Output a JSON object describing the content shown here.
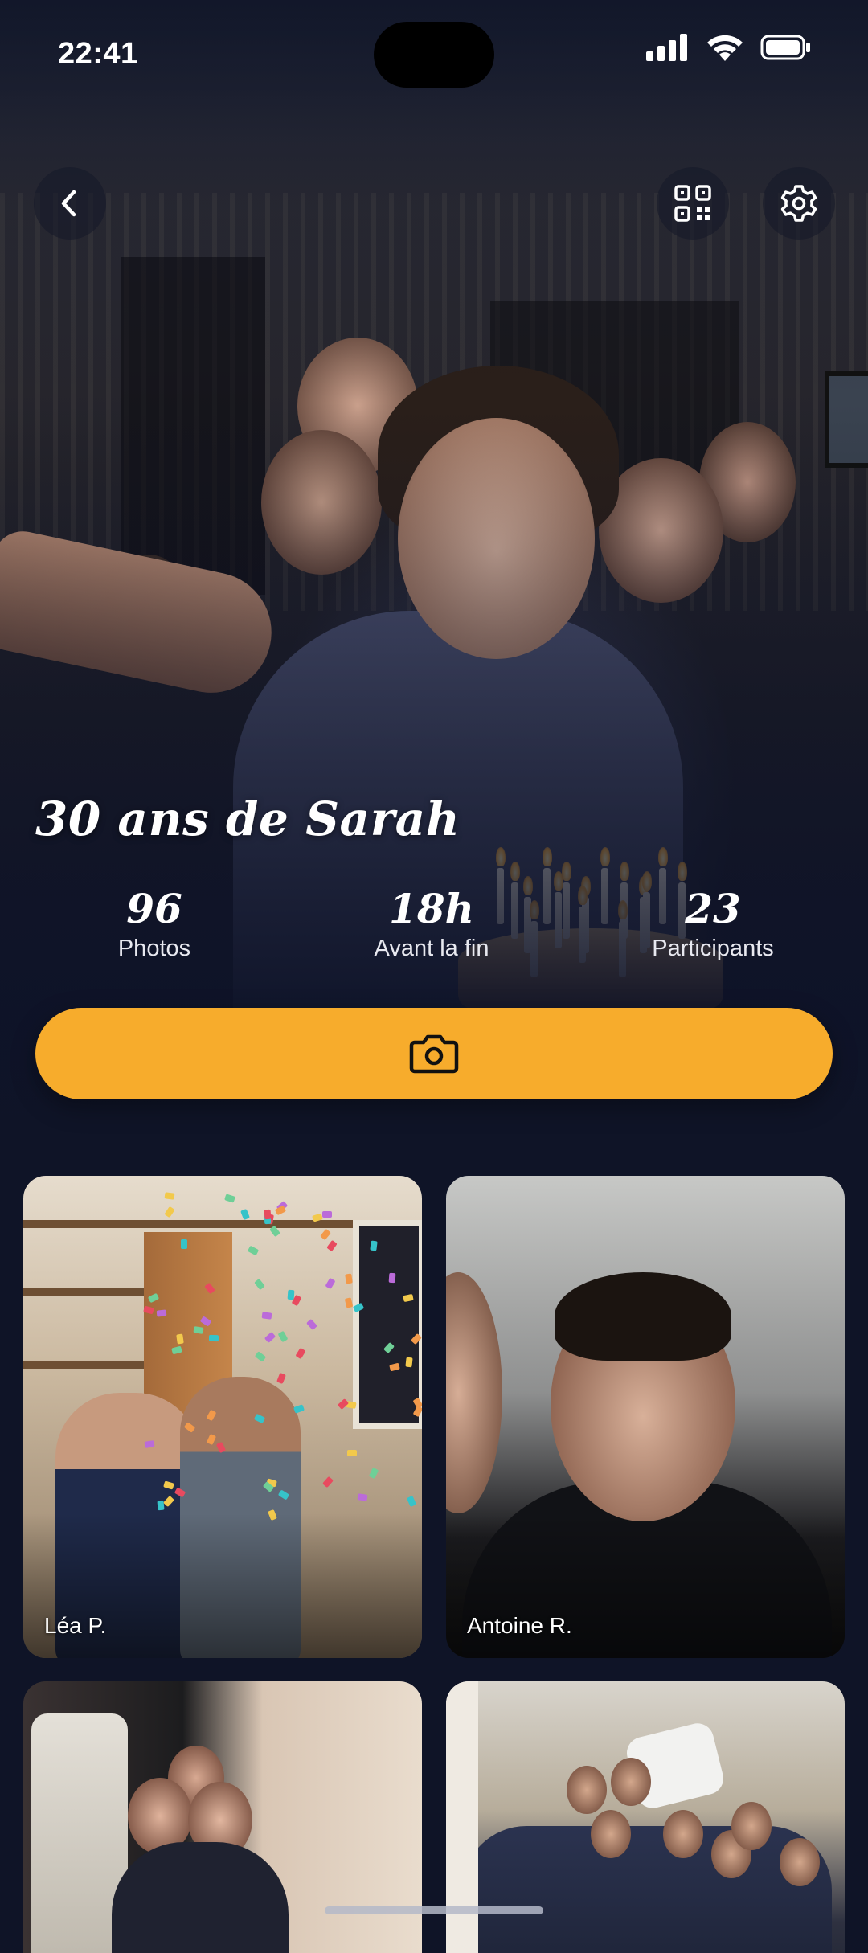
{
  "status_bar": {
    "time": "22:41",
    "icons": [
      "cellular-signal-icon",
      "wifi-icon",
      "battery-icon"
    ]
  },
  "header": {
    "back_icon": "chevron-left-icon",
    "qr_icon": "qr-code-icon",
    "settings_icon": "gear-icon"
  },
  "event": {
    "title": "30 ans de Sarah",
    "stats": [
      {
        "value": "96",
        "label": "Photos"
      },
      {
        "value": "18h",
        "label": "Avant la fin"
      },
      {
        "value": "23",
        "label": "Participants"
      }
    ]
  },
  "capture_button": {
    "icon": "camera-icon",
    "color": "#f7ac2c"
  },
  "photos": [
    {
      "author": "Léa P."
    },
    {
      "author": "Antoine R."
    },
    {
      "author": ""
    },
    {
      "author": ""
    }
  ],
  "colors": {
    "background": "#0f1427",
    "accent": "#f7ac2c"
  }
}
